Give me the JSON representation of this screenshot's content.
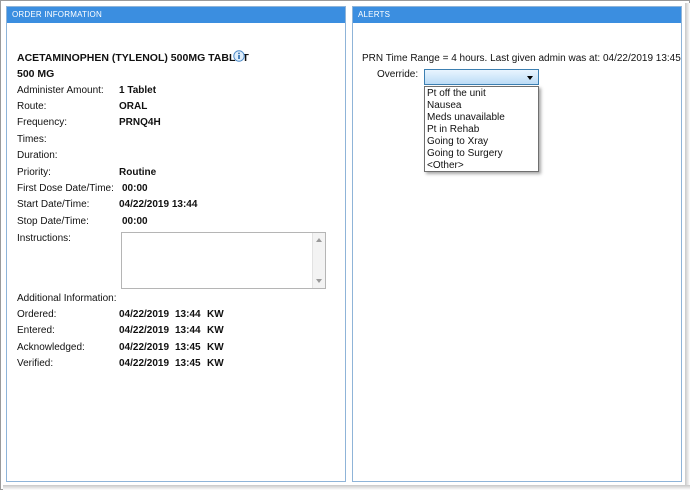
{
  "order_panel": {
    "header": "ORDER INFORMATION",
    "drug_name": "ACETAMINOPHEN (TYLENOL) 500MG TABLET",
    "dose": "500   MG",
    "fields": [
      {
        "label": "Administer Amount:",
        "value": "1 Tablet"
      },
      {
        "label": "Route:",
        "value": "ORAL"
      },
      {
        "label": "Frequency:",
        "value": "PRNQ4H"
      },
      {
        "label": "Times:",
        "value": ""
      },
      {
        "label": "Duration:",
        "value": ""
      },
      {
        "label": "Priority:",
        "value": "Routine"
      },
      {
        "label": "First Dose Date/Time:",
        "value": "00:00"
      },
      {
        "label": "Start Date/Time:",
        "value": "04/22/2019 13:44"
      },
      {
        "label": "Stop Date/Time:",
        "value": "00:00"
      },
      {
        "label": "Instructions:",
        "value": ""
      }
    ],
    "additional_info_label": "Additional Information:",
    "additional": [
      {
        "label": "Ordered:",
        "date": "04/22/2019",
        "time": "13:44",
        "user": "KW"
      },
      {
        "label": "Entered:",
        "date": "04/22/2019",
        "time": "13:44",
        "user": "KW"
      },
      {
        "label": "Acknowledged:",
        "date": "04/22/2019",
        "time": "13:45",
        "user": "KW"
      },
      {
        "label": "Verified:",
        "date": "04/22/2019",
        "time": "13:45",
        "user": "KW"
      }
    ]
  },
  "alerts_panel": {
    "header": "ALERTS",
    "prn_message": "PRN Time Range = 4 hours.   Last given admin was at: 04/22/2019 13:45",
    "override_label": "Override:",
    "override_value": "",
    "override_options": [
      "Pt off the unit",
      "Nausea",
      "Meds unavailable",
      "Pt in Rehab",
      "Going to Xray",
      "Going to Surgery",
      "<Other>"
    ]
  },
  "icons": {
    "info": "info-icon",
    "dropdown": "chevron-down-icon"
  },
  "colors": {
    "header_bg": "#3b8ee0",
    "header_text": "#ffffff",
    "select_border": "#3c7fb1"
  }
}
